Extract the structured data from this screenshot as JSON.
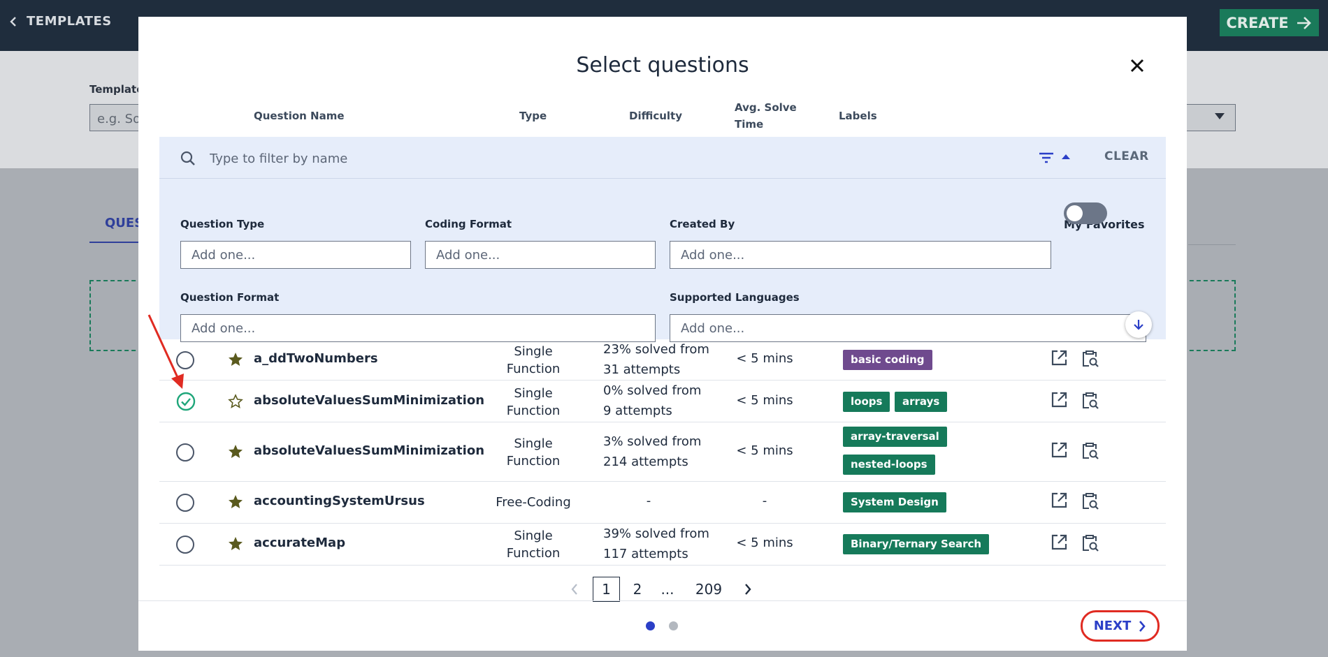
{
  "background": {
    "back_label": "TEMPLATES",
    "create_label": "CREATE",
    "template_label": "Template",
    "template_placeholder": "e.g. So",
    "tab_label": "QUES"
  },
  "modal": {
    "title": "Select questions",
    "columns": {
      "name": "Question Name",
      "type": "Type",
      "difficulty": "Difficulty",
      "avg_time": "Avg. Solve Time",
      "labels": "Labels"
    },
    "search_placeholder": "Type to filter by name",
    "clear_label": "CLEAR",
    "filters": {
      "question_type": {
        "label": "Question Type",
        "placeholder": "Add one..."
      },
      "coding_format": {
        "label": "Coding Format",
        "placeholder": "Add one..."
      },
      "created_by": {
        "label": "Created By",
        "placeholder": "Add one..."
      },
      "my_favorites": {
        "label": "My Favorites",
        "enabled": false
      },
      "question_format": {
        "label": "Question Format",
        "placeholder": "Add one..."
      },
      "supported_languages": {
        "label": "Supported Languages",
        "placeholder": "Add one..."
      }
    },
    "rows": [
      {
        "name": "a_ddTwoNumbers",
        "favorite": true,
        "selected": false,
        "type_line1": "Single",
        "type_line2": "Function",
        "diff_line1": "23% solved from",
        "diff_line2": "31 attempts",
        "time": "< 5 mins",
        "tags": [
          "basic coding"
        ]
      },
      {
        "name": "absoluteValuesSumMinimization",
        "favorite": false,
        "selected": true,
        "type_line1": "Single",
        "type_line2": "Function",
        "diff_line1": "0% solved from",
        "diff_line2": "9 attempts",
        "time": "< 5 mins",
        "tags": [
          "loops",
          "arrays"
        ]
      },
      {
        "name": "absoluteValuesSumMinimization",
        "favorite": true,
        "selected": false,
        "type_line1": "Single",
        "type_line2": "Function",
        "diff_line1": "3% solved from",
        "diff_line2": "214 attempts",
        "time": "< 5 mins",
        "tags": [
          "array-traversal",
          "nested-loops"
        ]
      },
      {
        "name": "accountingSystemUrsus",
        "favorite": true,
        "selected": false,
        "type_line1": "Free-Coding",
        "type_line2": "",
        "diff_line1": "-",
        "diff_line2": "",
        "time": "-",
        "tags": [
          "System Design"
        ]
      },
      {
        "name": "accurateMap",
        "favorite": true,
        "selected": false,
        "type_line1": "Single",
        "type_line2": "Function",
        "diff_line1": "39% solved from",
        "diff_line2": "117 attempts",
        "time": "< 5 mins",
        "tags": [
          "Binary/Ternary Search"
        ]
      }
    ],
    "pagination": {
      "current": "1",
      "page2": "2",
      "ellipsis": "...",
      "last": "209"
    },
    "steps": {
      "active": 1,
      "total": 2
    },
    "next_label": "NEXT"
  },
  "colors": {
    "tag_purple": "#6f4a8e",
    "tag_green": "#167a5a",
    "selected_check": "#1fa67a",
    "star": "#5a5a1e",
    "accent_blue": "#2b3fc7",
    "annotation_red": "#e02b22"
  }
}
